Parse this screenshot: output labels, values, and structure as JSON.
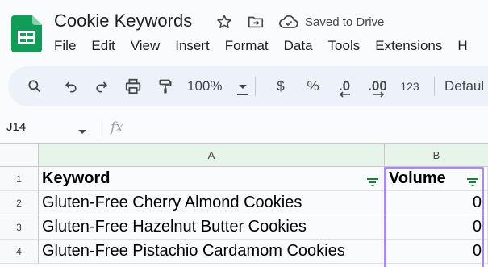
{
  "app": {
    "title": "Cookie Keywords",
    "status": "Saved to Drive"
  },
  "menu": [
    "File",
    "Edit",
    "View",
    "Insert",
    "Format",
    "Data",
    "Tools",
    "Extensions",
    "H"
  ],
  "toolbar": {
    "zoom": "100%",
    "currency": "$",
    "percent": "%",
    "dec_decrease": ".0",
    "dec_increase": ".00",
    "number_format": "123",
    "font": "Defaul"
  },
  "formula_bar": {
    "name_box": "J14",
    "fx": "fx",
    "value": ""
  },
  "sheet": {
    "columns": [
      "A",
      "B"
    ],
    "row_numbers": [
      "1",
      "2",
      "3",
      "4"
    ],
    "headers": {
      "a": "Keyword",
      "b": "Volume"
    },
    "rows": [
      {
        "keyword": "Gluten-Free Cherry Almond Cookies",
        "volume": "0"
      },
      {
        "keyword": "Gluten-Free Hazelnut Butter Cookies",
        "volume": "0"
      },
      {
        "keyword": "Gluten-Free Pistachio Cardamom Cookies",
        "volume": "0"
      }
    ]
  },
  "colors": {
    "logo": "#0f9d58",
    "selected_column_header": "#e6f4ea",
    "selection_border": "#a78bf0",
    "filter_icon": "#188038"
  }
}
